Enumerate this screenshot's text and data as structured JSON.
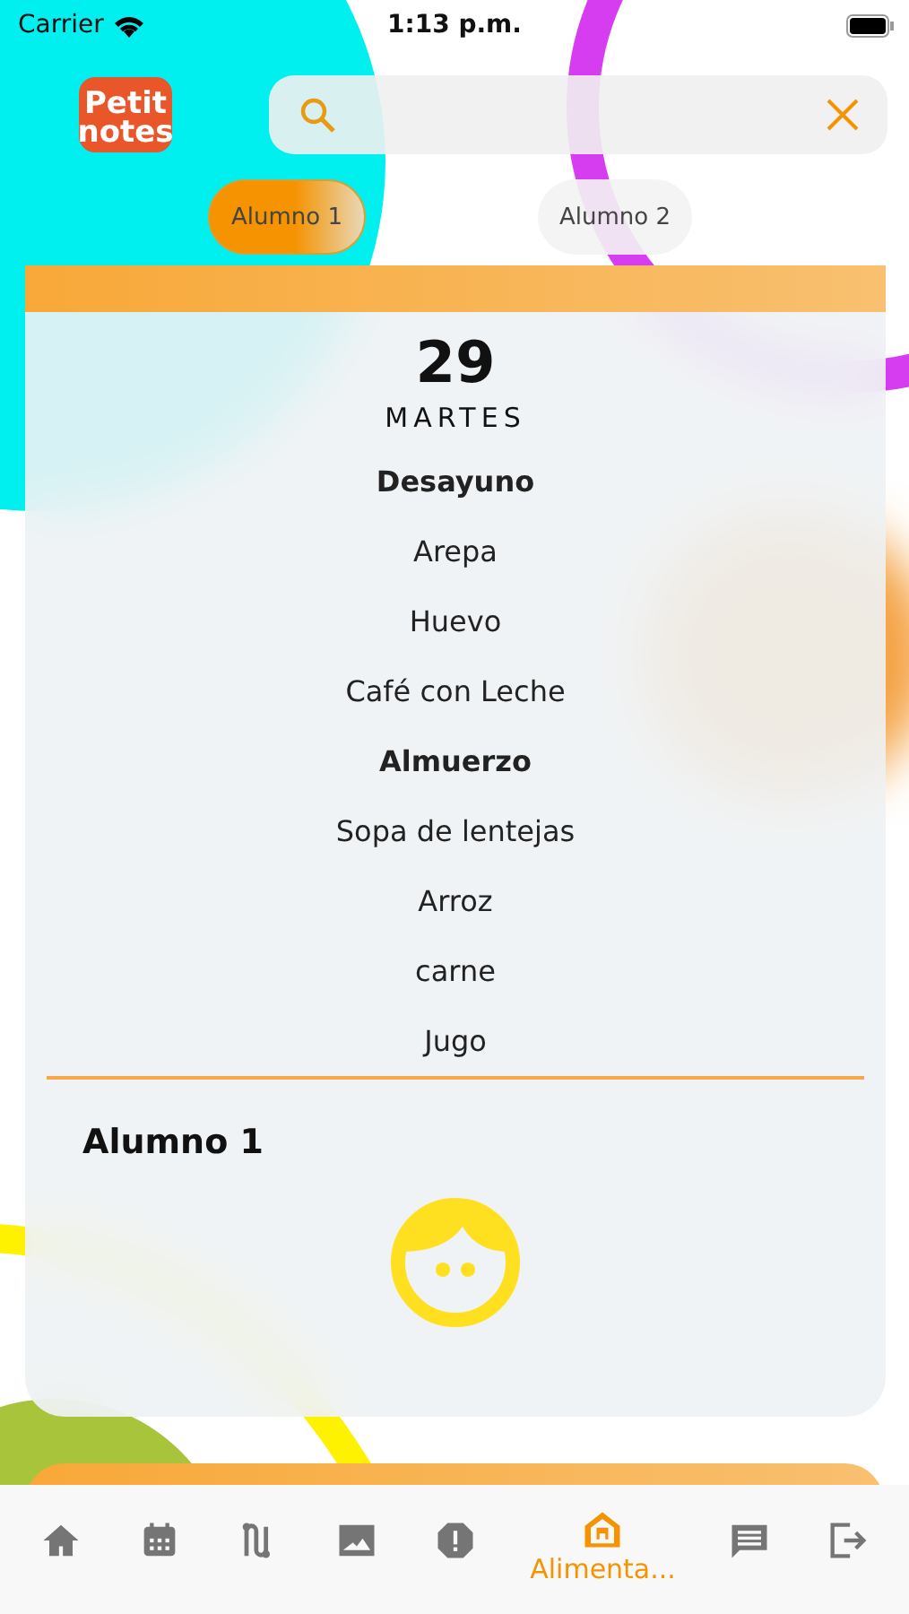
{
  "status_bar": {
    "carrier": "Carrier",
    "time": "1:13 p.m."
  },
  "logo": {
    "line_1": "Petit",
    "line_2": "notes"
  },
  "students": [
    {
      "label": "Alumno 1",
      "selected": true
    },
    {
      "label": "Alumno 2",
      "selected": false
    }
  ],
  "day": {
    "number": "29",
    "weekday": "MARTES"
  },
  "menu": [
    {
      "kind": "heading",
      "text": "Desayuno"
    },
    {
      "kind": "item",
      "text": "Arepa"
    },
    {
      "kind": "item",
      "text": "Huevo"
    },
    {
      "kind": "item",
      "text": "Café con Leche"
    },
    {
      "kind": "heading",
      "text": "Almuerzo"
    },
    {
      "kind": "item",
      "text": "Sopa de lentejas"
    },
    {
      "kind": "item",
      "text": "Arroz"
    },
    {
      "kind": "item",
      "text": "carne"
    },
    {
      "kind": "item",
      "text": "Jugo"
    }
  ],
  "student_name": "Alumno 1",
  "tab_bar": [
    {
      "selected": false
    },
    {
      "selected": false
    },
    {
      "selected": false
    },
    {
      "selected": false
    },
    {
      "selected": false
    },
    {
      "selected": true,
      "label": "Alimenta..."
    },
    {
      "selected": false
    },
    {
      "selected": false
    }
  ]
}
